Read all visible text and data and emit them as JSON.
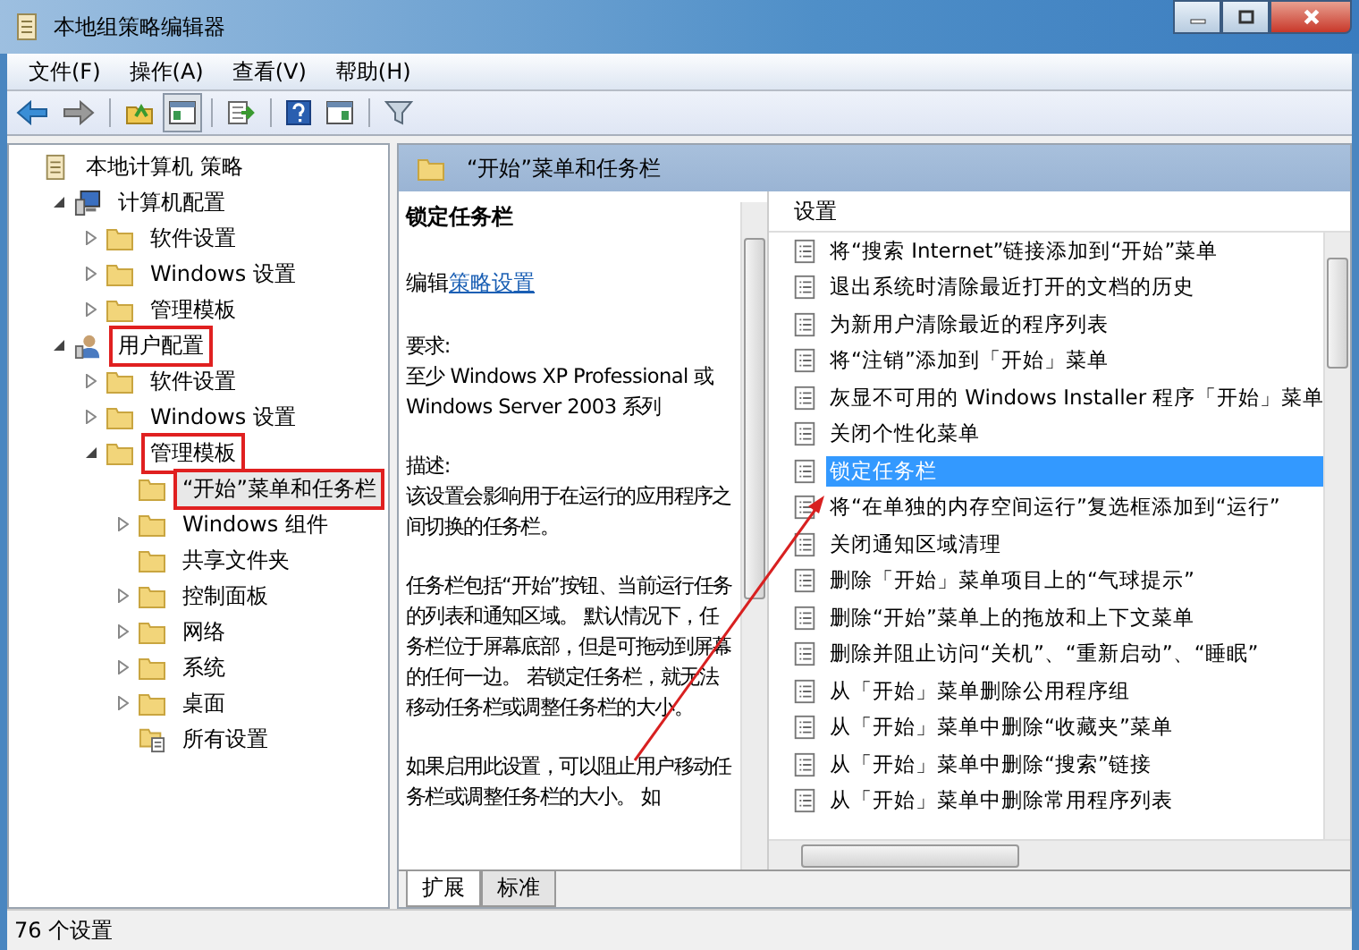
{
  "window": {
    "title": "本地组策略编辑器"
  },
  "menu": [
    "文件(F)",
    "操作(A)",
    "查看(V)",
    "帮助(H)"
  ],
  "toolbar": [
    {
      "kind": "back"
    },
    {
      "kind": "forward"
    },
    {
      "kind": "sep"
    },
    {
      "kind": "up"
    },
    {
      "kind": "tree",
      "pressed": true
    },
    {
      "kind": "sep"
    },
    {
      "kind": "export"
    },
    {
      "kind": "sep"
    },
    {
      "kind": "help"
    },
    {
      "kind": "view"
    },
    {
      "kind": "sep"
    },
    {
      "kind": "filter"
    }
  ],
  "tree": [
    {
      "label": "本地计算机 策略",
      "kind": "policy",
      "selected": false,
      "annotated": false,
      "children": [
        {
          "label": "计算机配置",
          "kind": "computer",
          "expanded": true,
          "selected": false,
          "annotated": false,
          "children": [
            {
              "label": "软件设置",
              "kind": "folder",
              "expanded": false,
              "selected": false,
              "annotated": false
            },
            {
              "label": "Windows 设置",
              "kind": "folder",
              "expanded": false,
              "selected": false,
              "annotated": false
            },
            {
              "label": "管理模板",
              "kind": "folder",
              "expanded": false,
              "selected": false,
              "annotated": false
            }
          ]
        },
        {
          "label": "用户配置",
          "kind": "user",
          "expanded": true,
          "selected": false,
          "annotated": true,
          "children": [
            {
              "label": "软件设置",
              "kind": "folder",
              "expanded": false,
              "selected": false,
              "annotated": false
            },
            {
              "label": "Windows 设置",
              "kind": "folder",
              "expanded": false,
              "selected": false,
              "annotated": false
            },
            {
              "label": "管理模板",
              "kind": "folder",
              "expanded": true,
              "selected": false,
              "annotated": true,
              "children": [
                {
                  "label": "“开始”菜单和任务栏",
                  "kind": "folder",
                  "selected": true,
                  "annotated": true
                },
                {
                  "label": "Windows 组件",
                  "kind": "folder",
                  "expanded": false,
                  "selected": false,
                  "annotated": false
                },
                {
                  "label": "共享文件夹",
                  "kind": "folder",
                  "selected": false,
                  "annotated": false
                },
                {
                  "label": "控制面板",
                  "kind": "folder",
                  "expanded": false,
                  "selected": false,
                  "annotated": false
                },
                {
                  "label": "网络",
                  "kind": "folder",
                  "expanded": false,
                  "selected": false,
                  "annotated": false
                },
                {
                  "label": "系统",
                  "kind": "folder",
                  "expanded": false,
                  "selected": false,
                  "annotated": false
                },
                {
                  "label": "桌面",
                  "kind": "folder",
                  "expanded": false,
                  "selected": false,
                  "annotated": false
                },
                {
                  "label": "所有设置",
                  "kind": "all-settings",
                  "selected": false,
                  "annotated": false
                }
              ]
            }
          ]
        }
      ]
    }
  ],
  "pane_header": {
    "title": "“开始”菜单和任务栏"
  },
  "description": {
    "title": "锁定任务栏",
    "edit_prefix": "编辑",
    "edit_link": "策略设置",
    "paragraphs": [
      "要求:\n至少 Windows XP Professional 或 Windows Server 2003 系列",
      "描述:\n该设置会影响用于在运行的应用程序之间切换的任务栏。",
      "任务栏包括“开始”按钮、当前运行任务的列表和通知区域。 默认情况下，任务栏位于屏幕底部，但是可拖动到屏幕的任何一边。 若锁定任务栏，就无法移动任务栏或调整任务栏的大小。",
      "如果启用此设置，可以阻止用户移动任务栏或调整任务栏的大小。 如"
    ]
  },
  "settings": {
    "column": "设置",
    "rows": [
      {
        "label": "将“搜索 Internet”链接添加到“开始”菜单",
        "selected": false
      },
      {
        "label": "退出系统时清除最近打开的文档的历史",
        "selected": false
      },
      {
        "label": "为新用户清除最近的程序列表",
        "selected": false
      },
      {
        "label": "将“注销”添加到「开始」菜单",
        "selected": false
      },
      {
        "label": "灰显不可用的 Windows Installer 程序「开始」菜单",
        "selected": false
      },
      {
        "label": "关闭个性化菜单",
        "selected": false
      },
      {
        "label": "锁定任务栏",
        "selected": true
      },
      {
        "label": "将“在单独的内存空间运行”复选框添加到“运行”",
        "selected": false
      },
      {
        "label": "关闭通知区域清理",
        "selected": false
      },
      {
        "label": "删除「开始」菜单项目上的“气球提示”",
        "selected": false
      },
      {
        "label": "删除“开始”菜单上的拖放和上下文菜单",
        "selected": false
      },
      {
        "label": "删除并阻止访问“关机”、“重新启动”、“睡眠”",
        "selected": false
      },
      {
        "label": "从「开始」菜单删除公用程序组",
        "selected": false
      },
      {
        "label": "从「开始」菜单中删除“收藏夹”菜单",
        "selected": false
      },
      {
        "label": "从「开始」菜单中删除“搜索”链接",
        "selected": false
      },
      {
        "label": "从「开始」菜单中删除常用程序列表",
        "selected": false
      }
    ]
  },
  "tabs": [
    {
      "label": "扩展",
      "selected": true
    },
    {
      "label": "标准",
      "selected": false
    }
  ],
  "status_bar": "76 个设置"
}
